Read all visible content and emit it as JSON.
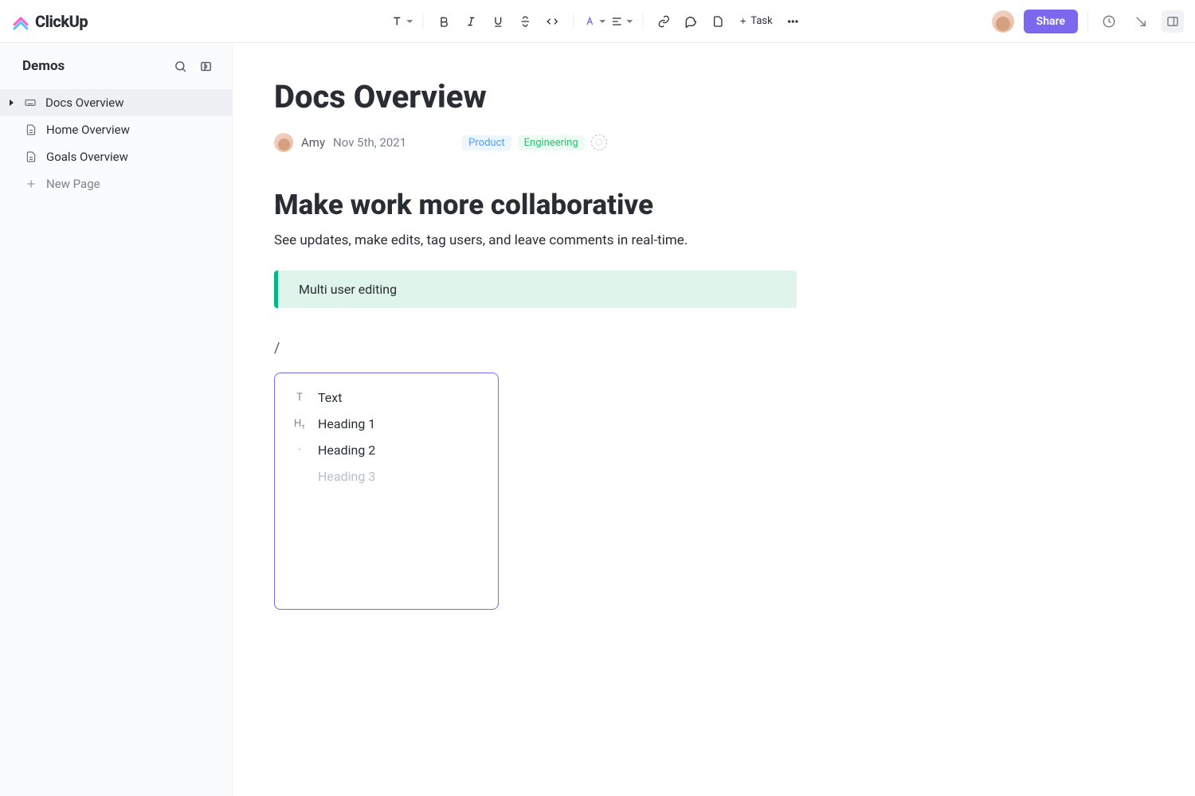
{
  "app": {
    "name": "ClickUp"
  },
  "toolbar": {
    "task_label": "Task"
  },
  "header": {
    "share_label": "Share"
  },
  "sidebar": {
    "title": "Demos",
    "items": [
      {
        "label": "Docs Overview",
        "active": true,
        "icon": "keyboard"
      },
      {
        "label": "Home Overview",
        "active": false,
        "icon": "doc"
      },
      {
        "label": "Goals Overview",
        "active": false,
        "icon": "doc"
      }
    ],
    "new_page_label": "New Page"
  },
  "doc": {
    "title": "Docs Overview",
    "author": "Amy",
    "date": "Nov 5th, 2021",
    "tags": [
      {
        "label": "Product",
        "kind": "product"
      },
      {
        "label": "Engineering",
        "kind": "engineering"
      }
    ],
    "heading": "Make work more collaborative",
    "paragraph": "See updates, make edits, tag users, and leave comments in real-time.",
    "callout": "Multi user editing",
    "slash_trigger": "/"
  },
  "slash_menu": {
    "items": [
      {
        "label": "Text",
        "icon": "T",
        "ghost": false
      },
      {
        "label": "Heading 1",
        "icon": "H₁",
        "ghost": false
      },
      {
        "label": "Heading 2",
        "icon": "·",
        "ghost": false
      },
      {
        "label": "Heading 3",
        "icon": "",
        "ghost": true
      }
    ]
  },
  "colors": {
    "accent": "#7b68ee",
    "callout_bg": "#dff4ea",
    "callout_border": "#00b884"
  }
}
